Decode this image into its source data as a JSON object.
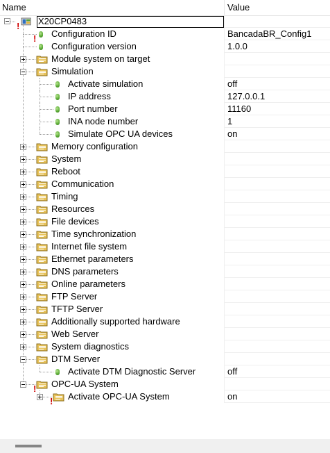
{
  "header": {
    "name_col": "Name",
    "value_col": "Value"
  },
  "root": {
    "label": "X20CP0483"
  },
  "rows": [
    {
      "label": "Configuration ID",
      "value": "BancadaBR_Config1"
    },
    {
      "label": "Configuration version",
      "value": "1.0.0"
    },
    {
      "label": "Module system on target",
      "value": ""
    },
    {
      "label": "Simulation",
      "value": ""
    },
    {
      "label": "Activate simulation",
      "value": "off"
    },
    {
      "label": "IP address",
      "value": "127.0.0.1"
    },
    {
      "label": "Port number",
      "value": "11160"
    },
    {
      "label": "INA node number",
      "value": "1"
    },
    {
      "label": "Simulate OPC UA devices",
      "value": "on"
    },
    {
      "label": "Memory configuration",
      "value": ""
    },
    {
      "label": "System",
      "value": ""
    },
    {
      "label": "Reboot",
      "value": ""
    },
    {
      "label": "Communication",
      "value": ""
    },
    {
      "label": "Timing",
      "value": ""
    },
    {
      "label": "Resources",
      "value": ""
    },
    {
      "label": "File devices",
      "value": ""
    },
    {
      "label": "Time synchronization",
      "value": ""
    },
    {
      "label": "Internet file system",
      "value": ""
    },
    {
      "label": "Ethernet parameters",
      "value": ""
    },
    {
      "label": "DNS parameters",
      "value": ""
    },
    {
      "label": "Online parameters",
      "value": ""
    },
    {
      "label": "FTP Server",
      "value": ""
    },
    {
      "label": "TFTP Server",
      "value": ""
    },
    {
      "label": "Additionally supported hardware",
      "value": ""
    },
    {
      "label": "Web Server",
      "value": ""
    },
    {
      "label": "System diagnostics",
      "value": ""
    },
    {
      "label": "DTM Server",
      "value": ""
    },
    {
      "label": "Activate DTM Diagnostic Server",
      "value": "off"
    },
    {
      "label": "OPC-UA System",
      "value": ""
    },
    {
      "label": "Activate OPC-UA System",
      "value": "on"
    }
  ],
  "colors": {
    "leaf_dot": "#5fae3a",
    "warning": "#d00000",
    "folder": "#e8c35a"
  },
  "icons": {
    "leaf": "parameter-leaf-icon",
    "folder": "parameter-folder-icon",
    "root": "cpu-module-icon",
    "warning": "warning-exclamation-icon"
  }
}
